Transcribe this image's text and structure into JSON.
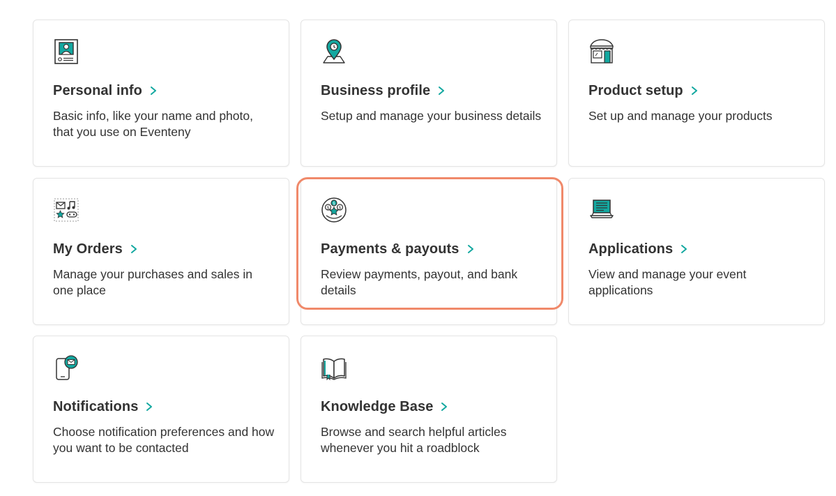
{
  "colors": {
    "accent": "#13a8a0",
    "highlight": "#f0896a",
    "text": "#333333"
  },
  "cards": [
    {
      "icon": "id-card-icon",
      "title": "Personal info",
      "desc": "Basic info, like your name and photo, that you use on Eventeny"
    },
    {
      "icon": "map-pin-icon",
      "title": "Business profile",
      "desc": "Setup and manage your business details"
    },
    {
      "icon": "storefront-icon",
      "title": "Product setup",
      "desc": "Set up and manage your products"
    },
    {
      "icon": "orders-icon",
      "title": "My Orders",
      "desc": "Manage your purchases and sales in one place"
    },
    {
      "icon": "payments-icon",
      "title": "Payments & payouts",
      "desc": "Review payments, payout, and bank details"
    },
    {
      "icon": "laptop-icon",
      "title": "Applications",
      "desc": "View and manage your event applications"
    },
    {
      "icon": "phone-mail-icon",
      "title": "Notifications",
      "desc": "Choose notification preferences and how you want to be contacted"
    },
    {
      "icon": "book-icon",
      "title": "Knowledge Base",
      "desc": "Browse and search helpful articles whenever you hit a roadblock"
    }
  ]
}
